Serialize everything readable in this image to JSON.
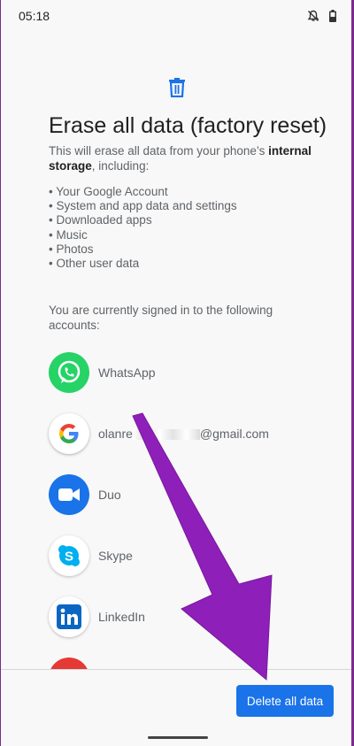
{
  "status_bar": {
    "time": "05:18"
  },
  "page": {
    "title": "Erase all data (factory reset)",
    "description_prefix": "This will erase all data from your phone’s ",
    "description_bold": "internal storage",
    "description_suffix": ", including:",
    "items": [
      "Your Google Account",
      "System and app data and settings",
      "Downloaded apps",
      "Music",
      "Photos",
      "Other user data"
    ],
    "accounts_intro": "You are currently signed in to the following accounts:"
  },
  "accounts": {
    "whatsapp": "WhatsApp",
    "google_prefix": "olanre",
    "google_suffix": "@gmail.com",
    "duo": "Duo",
    "skype": "Skype",
    "linkedin": "LinkedIn"
  },
  "actions": {
    "delete_label": "Delete all data"
  },
  "colors": {
    "primary": "#1a73e8",
    "annotation_arrow": "#8e1fb8"
  },
  "icons": [
    "trash-icon",
    "whatsapp-icon",
    "google-icon",
    "duo-icon",
    "skype-icon",
    "linkedin-icon",
    "mute-icon",
    "battery-icon"
  ]
}
